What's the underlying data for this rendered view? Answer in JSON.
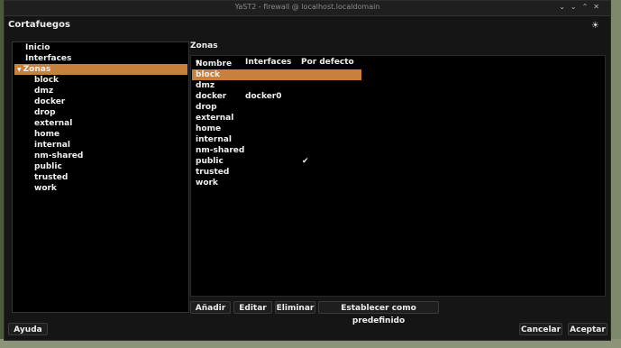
{
  "window": {
    "title": "YaST2 - firewall @ localhost.localdomain",
    "app_title": "Cortafuegos"
  },
  "tree": {
    "items": [
      {
        "label": "Inicio",
        "level": 0
      },
      {
        "label": "Interfaces",
        "level": 0
      },
      {
        "label": "Zonas",
        "level": 0,
        "expanded": true,
        "selected": true
      },
      {
        "label": "block",
        "level": 1
      },
      {
        "label": "dmz",
        "level": 1
      },
      {
        "label": "docker",
        "level": 1
      },
      {
        "label": "drop",
        "level": 1
      },
      {
        "label": "external",
        "level": 1
      },
      {
        "label": "home",
        "level": 1
      },
      {
        "label": "internal",
        "level": 1
      },
      {
        "label": "nm-shared",
        "level": 1
      },
      {
        "label": "public",
        "level": 1
      },
      {
        "label": "trusted",
        "level": 1
      },
      {
        "label": "work",
        "level": 1
      }
    ]
  },
  "zones_panel": {
    "title": "Zonas",
    "columns": [
      "Nombre",
      "Interfaces",
      "Por defecto"
    ],
    "rows": [
      {
        "name": "block",
        "interfaces": "",
        "default": "",
        "selected": true
      },
      {
        "name": "dmz",
        "interfaces": "",
        "default": ""
      },
      {
        "name": "docker",
        "interfaces": "docker0",
        "default": ""
      },
      {
        "name": "drop",
        "interfaces": "",
        "default": ""
      },
      {
        "name": "external",
        "interfaces": "",
        "default": ""
      },
      {
        "name": "home",
        "interfaces": "",
        "default": ""
      },
      {
        "name": "internal",
        "interfaces": "",
        "default": ""
      },
      {
        "name": "nm-shared",
        "interfaces": "",
        "default": ""
      },
      {
        "name": "public",
        "interfaces": "",
        "default": "✔"
      },
      {
        "name": "trusted",
        "interfaces": "",
        "default": ""
      },
      {
        "name": "work",
        "interfaces": "",
        "default": ""
      }
    ],
    "buttons": {
      "add": "Añadir",
      "edit": "Editar",
      "delete": "Eliminar",
      "set_default": "Establecer como predefinido"
    }
  },
  "footer": {
    "help": "Ayuda",
    "cancel": "Cancelar",
    "accept": "Aceptar"
  },
  "colors": {
    "selection": "#c8813c",
    "background": "#151515",
    "panel": "#000000"
  }
}
